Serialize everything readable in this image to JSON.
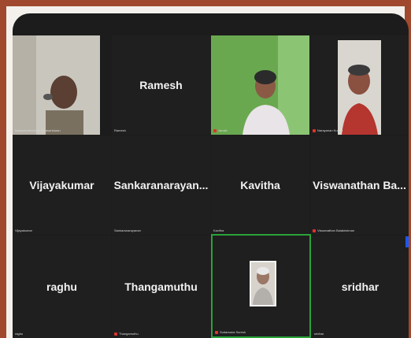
{
  "participants": [
    {
      "id": "p1",
      "display": "",
      "label": "Balasubramaniam Sivasankaran",
      "muted": false,
      "video": true
    },
    {
      "id": "p2",
      "display": "Ramesh",
      "label": "Ramesh",
      "muted": false,
      "video": false
    },
    {
      "id": "p3",
      "display": "",
      "label": "Janaki",
      "muted": true,
      "video": true
    },
    {
      "id": "p4",
      "display": "",
      "label": "Narayanan Kumar",
      "muted": true,
      "video": true
    },
    {
      "id": "p5",
      "display": "Vijayakumar",
      "label": "Vijayakumar",
      "muted": false,
      "video": false
    },
    {
      "id": "p6",
      "display": "Sankaranarayan...",
      "label": "Sankaranarayanan",
      "muted": false,
      "video": false
    },
    {
      "id": "p7",
      "display": "Kavitha",
      "label": "Kavitha",
      "muted": false,
      "video": false
    },
    {
      "id": "p8",
      "display": "Viswanathan  Ba...",
      "label": "Viswanathan Balakrishnan",
      "muted": true,
      "video": false
    },
    {
      "id": "p9",
      "display": "raghu",
      "label": "raghu",
      "muted": false,
      "video": false
    },
    {
      "id": "p10",
      "display": "Thangamuthu",
      "label": "Thangamuthu",
      "muted": true,
      "video": false
    },
    {
      "id": "p11",
      "display": "",
      "label": "Sudarsana Suresh",
      "muted": true,
      "video": false,
      "avatar": true
    },
    {
      "id": "p12",
      "display": "sridhar",
      "label": "sridhar",
      "muted": false,
      "video": false
    }
  ],
  "colors": {
    "outer_border": "#a0492e",
    "screen_bg": "#1c1c1c",
    "active_speaker": "#2aa33a",
    "muted": "#e0332d"
  }
}
